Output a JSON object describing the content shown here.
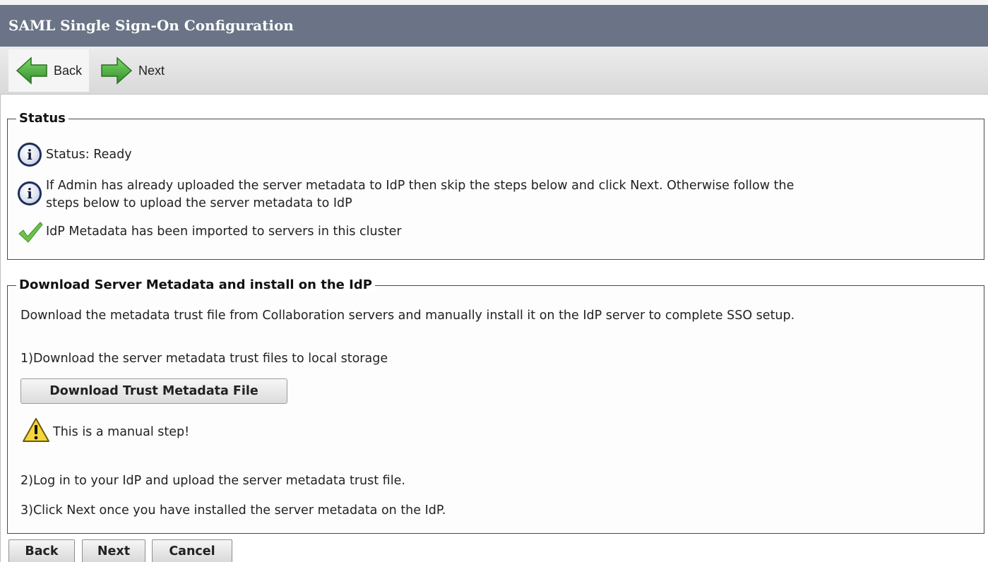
{
  "window": {
    "title": "SAML Single Sign-On Configuration"
  },
  "toolbar": {
    "back_label": "Back",
    "next_label": "Next"
  },
  "status_section": {
    "legend": "Status",
    "messages": [
      {
        "icon": "info-icon",
        "text": "Status: Ready"
      },
      {
        "icon": "info-icon",
        "line1": "If Admin has already uploaded the server metadata to IdP then skip the steps below and click Next. Otherwise follow the",
        "line2": "steps below to upload the server metadata to IdP"
      },
      {
        "icon": "checkmark-icon",
        "text": "IdP Metadata has been imported to servers in this cluster"
      }
    ]
  },
  "download_section": {
    "legend": "Download Server Metadata and install on the IdP",
    "intro": "Download the metadata trust file from Collaboration servers and manually install it on the IdP server to complete SSO setup.",
    "step1": "1)Download the server metadata trust files to local storage",
    "download_button": "Download Trust Metadata File",
    "warning": "This is a manual step!",
    "step2": "2)Log in to your IdP and upload the server metadata trust file.",
    "step3": "3)Click Next once you have installed the server metadata on the IdP."
  },
  "footer": {
    "back_label": "Back",
    "next_label": "Next",
    "cancel_label": "Cancel"
  },
  "colors": {
    "title_bar": "#6a7486",
    "arrow_green": "#3aa83a",
    "info_ring": "#1f2d5c",
    "warning_yellow": "#f6d73a"
  }
}
